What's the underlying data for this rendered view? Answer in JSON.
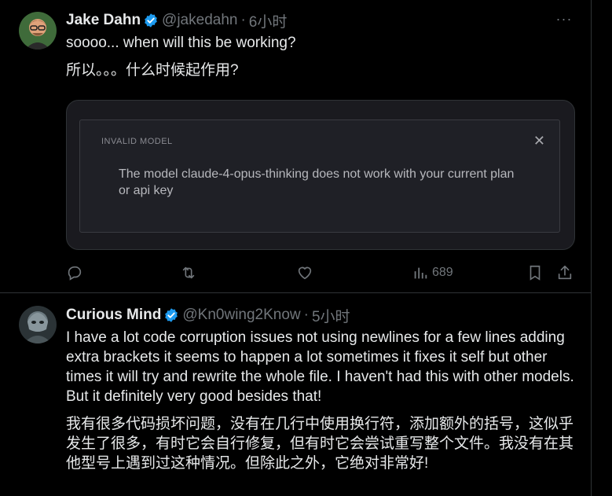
{
  "tweets": [
    {
      "name": "Jake Dahn",
      "handle": "@jakedahn",
      "dot": "·",
      "time": "6小时",
      "more": "···",
      "text_en": "soooo... when will this be working?",
      "text_zh": "所以。。。什么时候起作用?",
      "media": {
        "title": "INVALID MODEL",
        "close": "✕",
        "message": "The model claude-4-opus-thinking does not work with your current plan or api key"
      },
      "views": "689"
    },
    {
      "name": "Curious Mind",
      "handle": "@Kn0wing2Know",
      "dot": "·",
      "time": "5小时",
      "text_en": "I have a lot code corruption issues not using newlines for a few lines adding extra brackets it seems to happen a lot sometimes it fixes it self but other times it will try and rewrite the whole file. I haven't had this with other models. But it definitely very good besides that!",
      "text_zh": "我有很多代码损坏问题，没有在几行中使用换行符，添加额外的括号，这似乎发生了很多，有时它会自行修复，但有时它会尝试重写整个文件。我没有在其他型号上遇到过这种情况。但除此之外，它绝对非常好!"
    }
  ],
  "icons": [
    "verified-badge-icon",
    "more-icon",
    "reply-icon",
    "retweet-icon",
    "like-icon",
    "views-icon",
    "bookmark-icon",
    "share-icon",
    "close-icon"
  ],
  "colors": {
    "background": "#000000",
    "text": "#e7e9ea",
    "muted": "#71767b",
    "verified": "#1d9bf0",
    "border": "#2f3336"
  }
}
